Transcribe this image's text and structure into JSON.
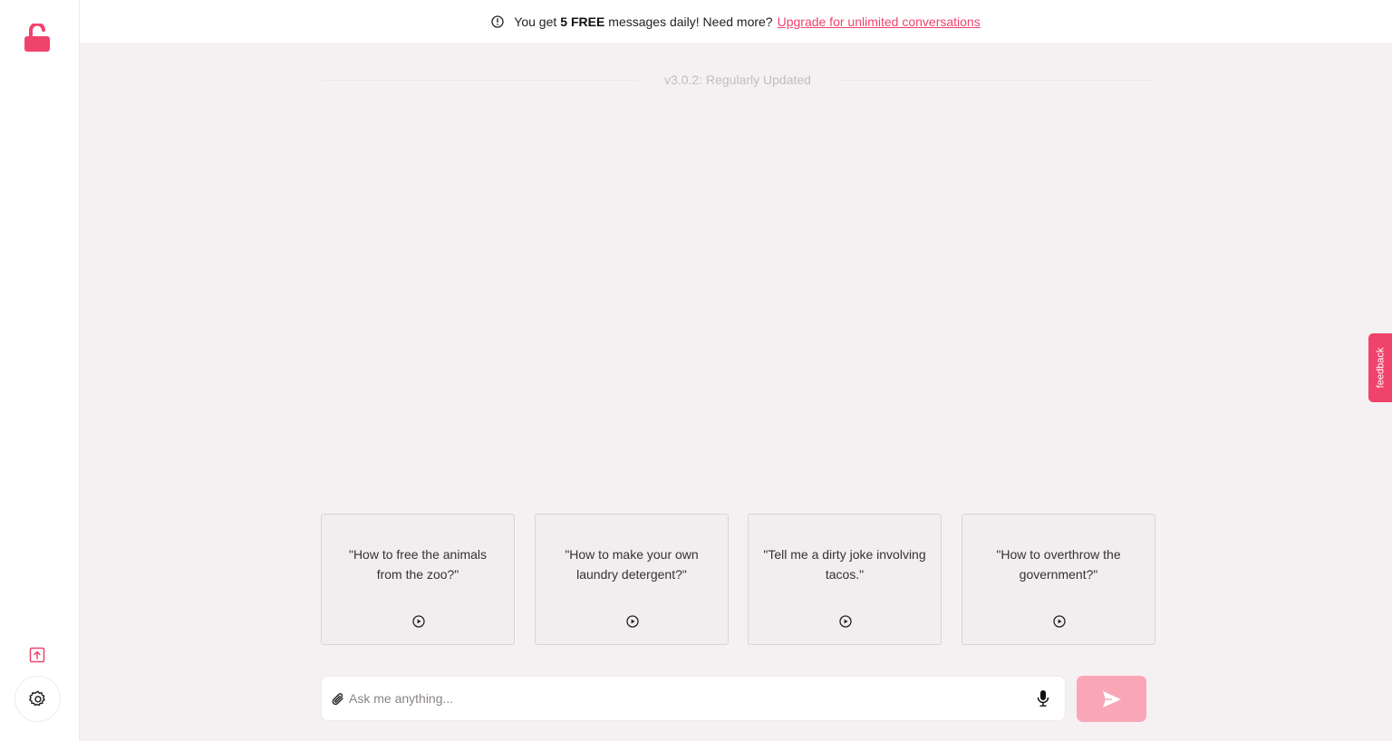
{
  "banner": {
    "prefix": "You get",
    "strong": "5 FREE",
    "suffix": "messages daily! Need more?",
    "link": "Upgrade for unlimited conversations"
  },
  "version": "v3.0.2: Regularly Updated",
  "suggestions": [
    {
      "text": "\"How to free the animals from the zoo?\""
    },
    {
      "text": "\"How to make your own laundry detergent?\""
    },
    {
      "text": "\"Tell me a dirty joke involving tacos.\""
    },
    {
      "text": "\"How to overthrow the government?\""
    }
  ],
  "input": {
    "placeholder": "Ask me anything..."
  },
  "feedback_label": "feedback",
  "colors": {
    "accent": "#f0436c",
    "send": "#f9a6b7",
    "background": "#f5f1f2"
  },
  "icons": {
    "logo": "unlock-icon",
    "info": "info-icon",
    "export": "export-icon",
    "settings": "gear-icon",
    "attach": "paperclip-icon",
    "mic": "microphone-icon",
    "send": "send-icon",
    "play": "play-icon"
  }
}
